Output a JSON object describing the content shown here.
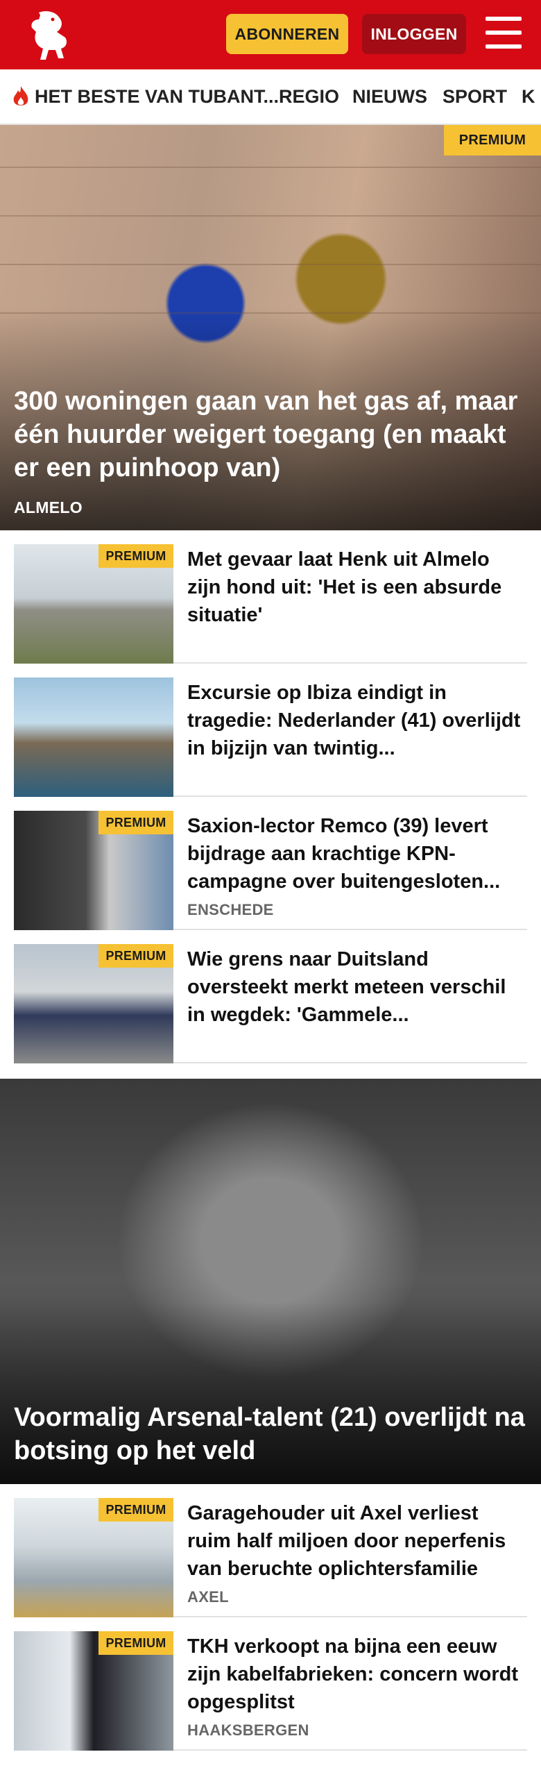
{
  "header": {
    "subscribe_label": "ABONNEREN",
    "login_label": "INLOGGEN",
    "brand_color": "#d60a15",
    "accent_color": "#f6c233"
  },
  "nav": {
    "items": [
      {
        "label": "HET BESTE VAN TUBANT...",
        "icon": "flame-icon"
      },
      {
        "label": "REGIO"
      },
      {
        "label": "NIEUWS"
      },
      {
        "label": "SPORT"
      },
      {
        "label": "K"
      }
    ]
  },
  "hero": {
    "badge": "PREMIUM",
    "title": "300 woningen gaan van het gas af, maar één huurder weigert toegang (en maakt er een puinhoop van)",
    "location": "ALMELO"
  },
  "articles": [
    {
      "badge": "PREMIUM",
      "title": "Met gevaar laat Henk uit Almelo zijn hond uit: 'Het is een absurde situatie'",
      "location": ""
    },
    {
      "badge": "",
      "title": "Excursie op Ibiza eindigt in tragedie: Nederlander (41) overlijdt in bijzijn van twintig...",
      "location": ""
    },
    {
      "badge": "PREMIUM",
      "title": "Saxion-lector Remco (39) levert bijdrage aan krachtige KPN-campagne over buitengesloten...",
      "location": "ENSCHEDE"
    },
    {
      "badge": "PREMIUM",
      "title": "Wie grens naar Duitsland oversteekt merkt meteen verschil in wegdek: 'Gammele...",
      "location": ""
    }
  ],
  "feature": {
    "title": "Voormalig Arsenal-talent (21) overlijdt na botsing op het veld"
  },
  "articles_bottom": [
    {
      "badge": "PREMIUM",
      "title": "Garagehouder uit Axel verliest ruim half miljoen door neperfenis van beruchte oplichtersfamilie",
      "location": "AXEL"
    },
    {
      "badge": "PREMIUM",
      "title": "TKH verkoopt na bijna een eeuw zijn kabelfabrieken: concern wordt opgesplitst",
      "location": "HAAKSBERGEN"
    }
  ]
}
